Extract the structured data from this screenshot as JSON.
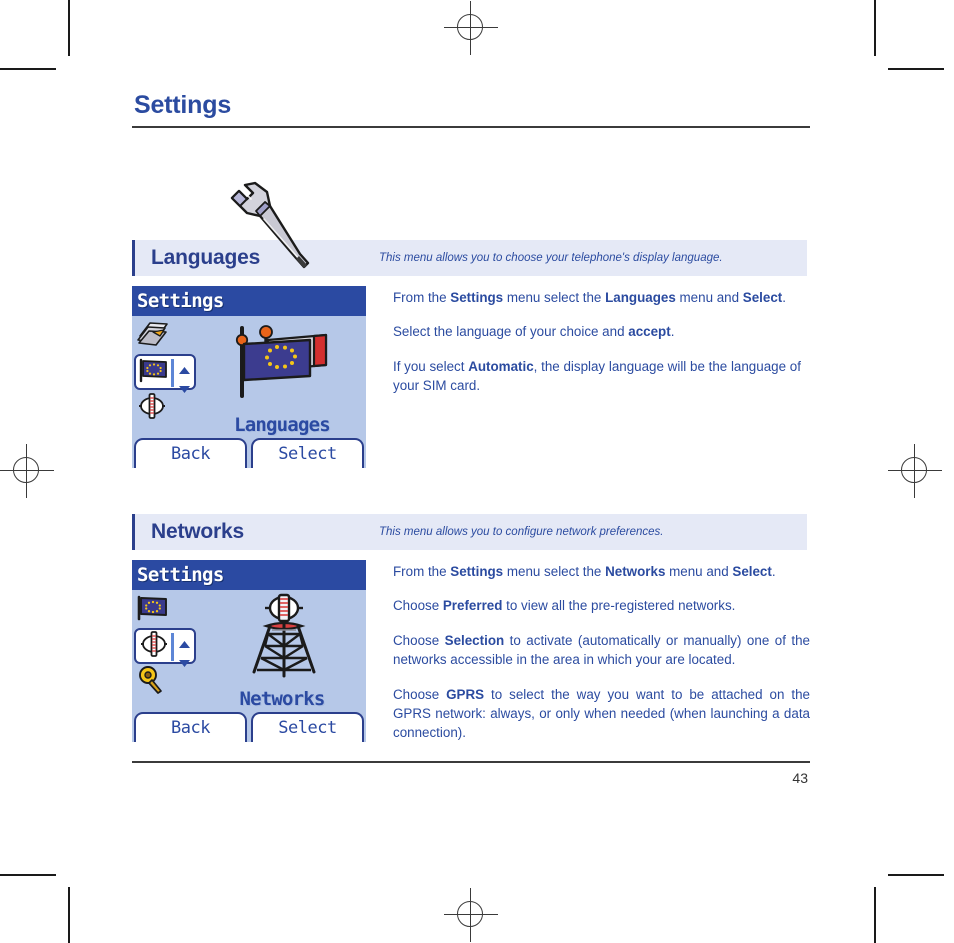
{
  "document": {
    "chapter_title": "Settings",
    "chapter_icon": "wrench-icon",
    "page_number": "43"
  },
  "sections": [
    {
      "id": "languages",
      "title": "Languages",
      "subtitle": "This menu allows you to choose your telephone's display language.",
      "phone": {
        "titlebar": "Settings",
        "hero_label": "Languages",
        "hero_icon": "eu-flag-icon",
        "rail": [
          {
            "icon": "folder-papers-icon",
            "selected": false
          },
          {
            "icon": "eu-flag-icon",
            "selected": true
          },
          {
            "icon": "network-gauge-icon",
            "selected": false
          }
        ],
        "softkey_left": "Back",
        "softkey_right": "Select"
      },
      "paragraphs": [
        "From the <b>Settings</b> menu select the <b>Languages</b> menu and <b>Select</b>.",
        "Select the language of your choice and <b>accept</b>.",
        "If you select <b>Automatic</b>, the display language will be the language of your SIM card."
      ],
      "justified": false
    },
    {
      "id": "networks",
      "title": "Networks",
      "subtitle": "This menu allows you to configure network preferences.",
      "phone": {
        "titlebar": "Settings",
        "hero_label": "Networks",
        "hero_icon": "antenna-tower-icon",
        "rail": [
          {
            "icon": "eu-flag-icon",
            "selected": false
          },
          {
            "icon": "network-gauge-icon",
            "selected": true
          },
          {
            "icon": "key-icon",
            "selected": false
          }
        ],
        "softkey_left": "Back",
        "softkey_right": "Select"
      },
      "paragraphs": [
        "From the <b>Settings</b> menu select the <b>Networks</b> menu and <b>Select</b>.",
        "Choose <b>Preferred</b> to view all the pre-registered networks.",
        "Choose <b>Selection</b> to activate (automatically or manually) one of the networks accessible in the area in which your are located.",
        "Choose <b>GPRS</b> to select the way you want to be attached on the GPRS network: always, or only when needed (when launching a data connection)."
      ],
      "justified": true
    }
  ],
  "colors": {
    "heading_blue": "#2b4ba0",
    "section_bar_bg": "#e5e9f6",
    "section_bar_accent": "#2b3f8c",
    "body_text_blue": "#2b4ba0",
    "phone_screen_bg": "#b6c8e8",
    "phone_titlebar_bg": "#2b4aa2"
  }
}
